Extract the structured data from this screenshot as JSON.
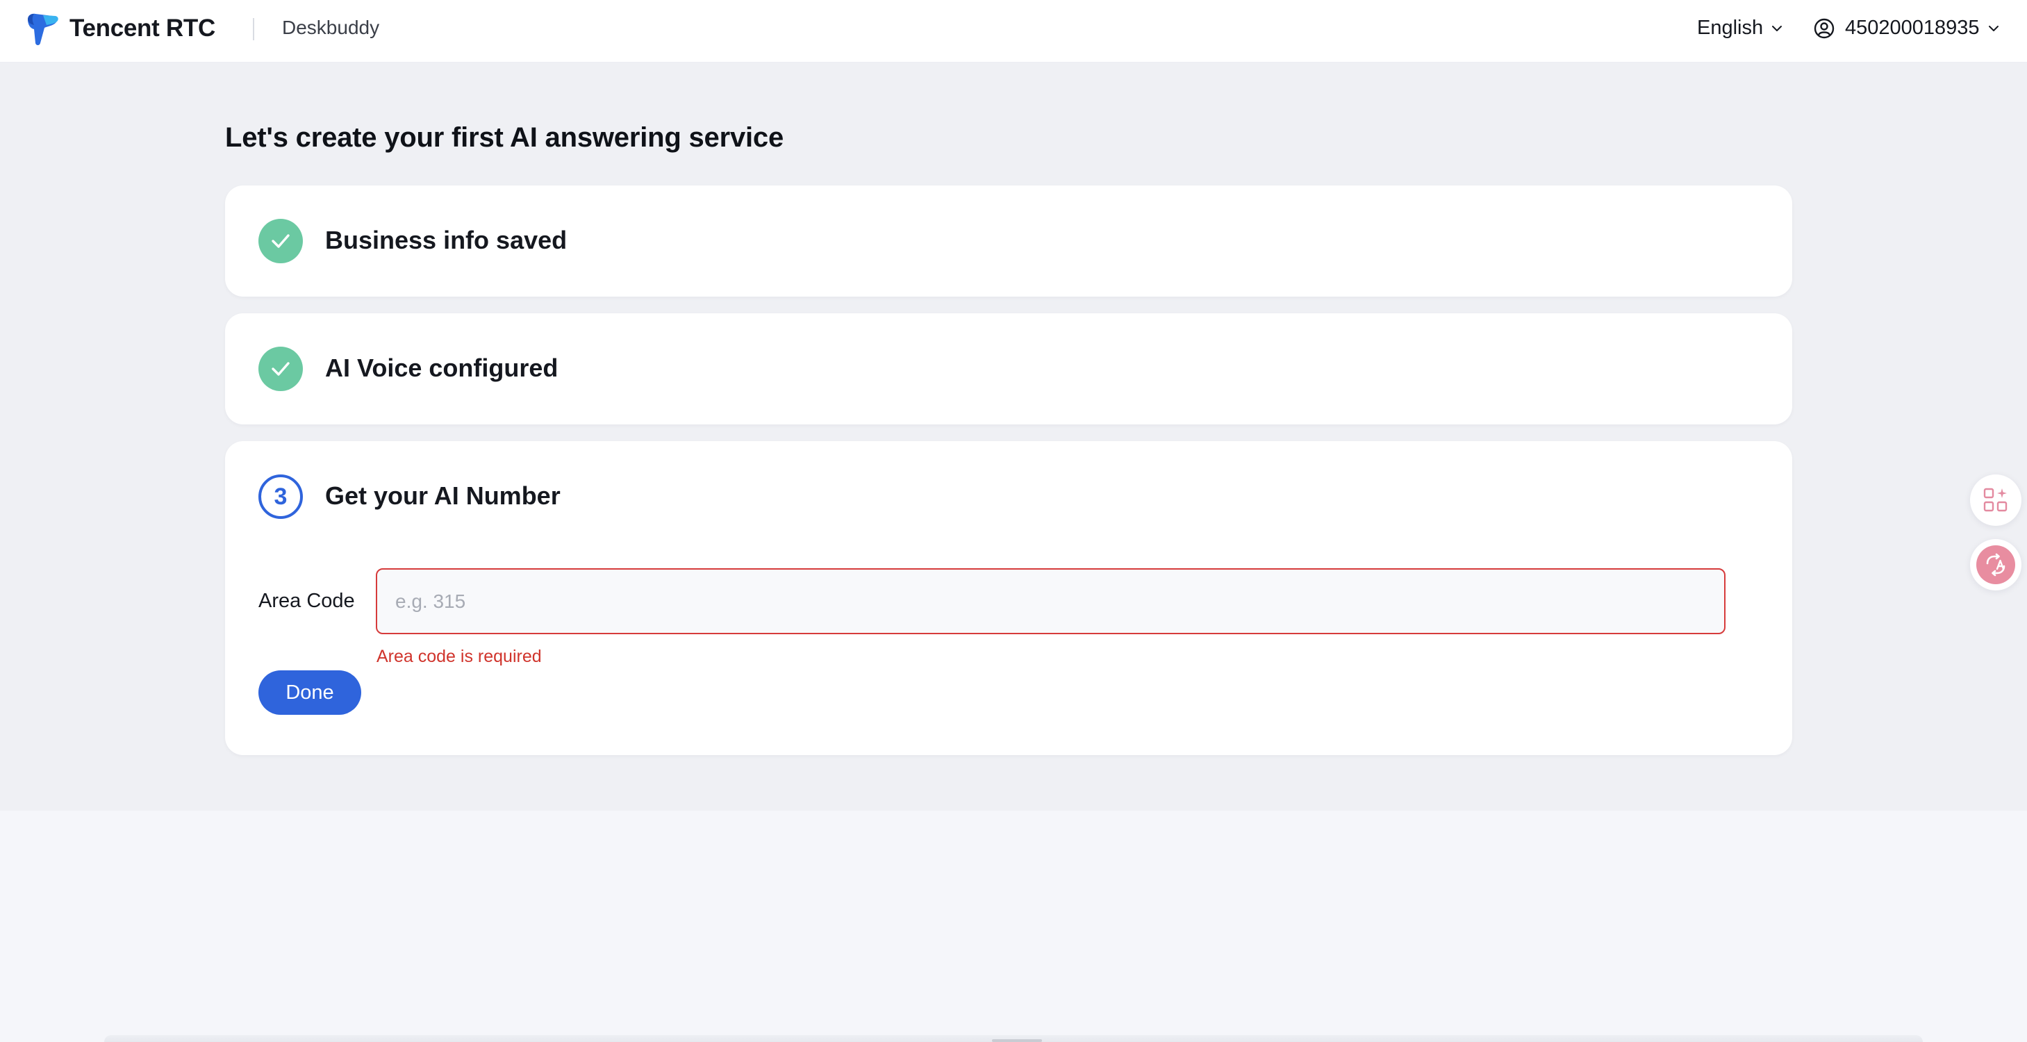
{
  "header": {
    "brand_name": "Tencent RTC",
    "product_name": "Deskbuddy",
    "language": "English",
    "account_id": "450200018935"
  },
  "page": {
    "title": "Let's create your first AI answering service"
  },
  "steps": [
    {
      "status": "done",
      "title": "Business info saved"
    },
    {
      "status": "done",
      "title": "AI Voice configured"
    },
    {
      "status": "current",
      "number": "3",
      "title": "Get your AI Number"
    }
  ],
  "form": {
    "area_code_label": "Area Code",
    "area_code_value": "",
    "area_code_placeholder": "e.g. 315",
    "area_code_error": "Area code is required",
    "done_label": "Done"
  },
  "colors": {
    "accent": "#2f64dc",
    "success": "#6bc9a2",
    "error": "#d0342c"
  },
  "side_tools": [
    {
      "icon": "apps-grid-icon"
    },
    {
      "icon": "translate-icon"
    }
  ]
}
